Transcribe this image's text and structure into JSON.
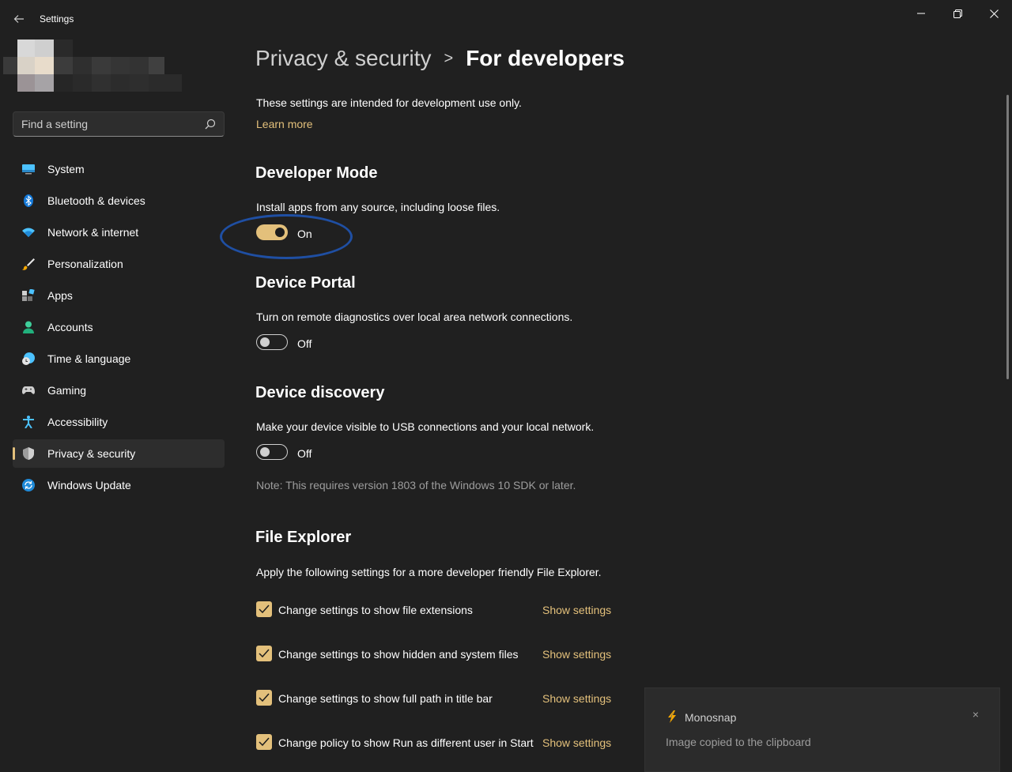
{
  "window": {
    "title": "Settings",
    "back_icon": "back-arrow-icon",
    "minimize_icon": "minimize-icon",
    "maximize_icon": "restore-icon",
    "close_icon": "close-icon"
  },
  "search": {
    "placeholder": "Find a setting",
    "icon": "search-icon"
  },
  "sidebar": {
    "items": [
      {
        "label": "System",
        "icon": "monitor-icon",
        "active": false
      },
      {
        "label": "Bluetooth & devices",
        "icon": "bluetooth-icon",
        "active": false
      },
      {
        "label": "Network & internet",
        "icon": "wifi-icon",
        "active": false
      },
      {
        "label": "Personalization",
        "icon": "brush-icon",
        "active": false
      },
      {
        "label": "Apps",
        "icon": "apps-icon",
        "active": false
      },
      {
        "label": "Accounts",
        "icon": "person-icon",
        "active": false
      },
      {
        "label": "Time & language",
        "icon": "globe-clock-icon",
        "active": false
      },
      {
        "label": "Gaming",
        "icon": "gamepad-icon",
        "active": false
      },
      {
        "label": "Accessibility",
        "icon": "accessibility-icon",
        "active": false
      },
      {
        "label": "Privacy & security",
        "icon": "shield-icon",
        "active": true
      },
      {
        "label": "Windows Update",
        "icon": "update-icon",
        "active": false
      }
    ]
  },
  "header": {
    "parent": "Privacy & security",
    "separator": ">",
    "current": "For developers"
  },
  "intro": {
    "text": "These settings are intended for development use only.",
    "learn_more": "Learn more"
  },
  "developer_mode": {
    "title": "Developer Mode",
    "description": "Install apps from any source, including loose files.",
    "state": "On"
  },
  "device_portal": {
    "title": "Device Portal",
    "description": "Turn on remote diagnostics over local area network connections.",
    "state": "Off"
  },
  "device_discovery": {
    "title": "Device discovery",
    "description": "Make your device visible to USB connections and your local network.",
    "state": "Off",
    "note": "Note: This requires version 1803 of the Windows 10 SDK or later."
  },
  "file_explorer": {
    "title": "File Explorer",
    "description": "Apply the following settings for a more developer friendly File Explorer.",
    "options": [
      {
        "label": "Change settings to show file extensions",
        "checked": true,
        "link": "Show settings"
      },
      {
        "label": "Change settings to show hidden and system files",
        "checked": true,
        "link": "Show settings"
      },
      {
        "label": "Change settings to show full path in title bar",
        "checked": true,
        "link": "Show settings"
      },
      {
        "label": "Change policy to show Run as different user in Start",
        "checked": true,
        "link": "Show settings"
      }
    ]
  },
  "toast": {
    "app": "Monosnap",
    "message": "Image copied to the clipboard",
    "close": "×",
    "icon": "monosnap-lightning-icon"
  },
  "colors": {
    "accent": "#e3c07b",
    "background": "#202020",
    "highlight_ring": "#1f4fa3"
  }
}
